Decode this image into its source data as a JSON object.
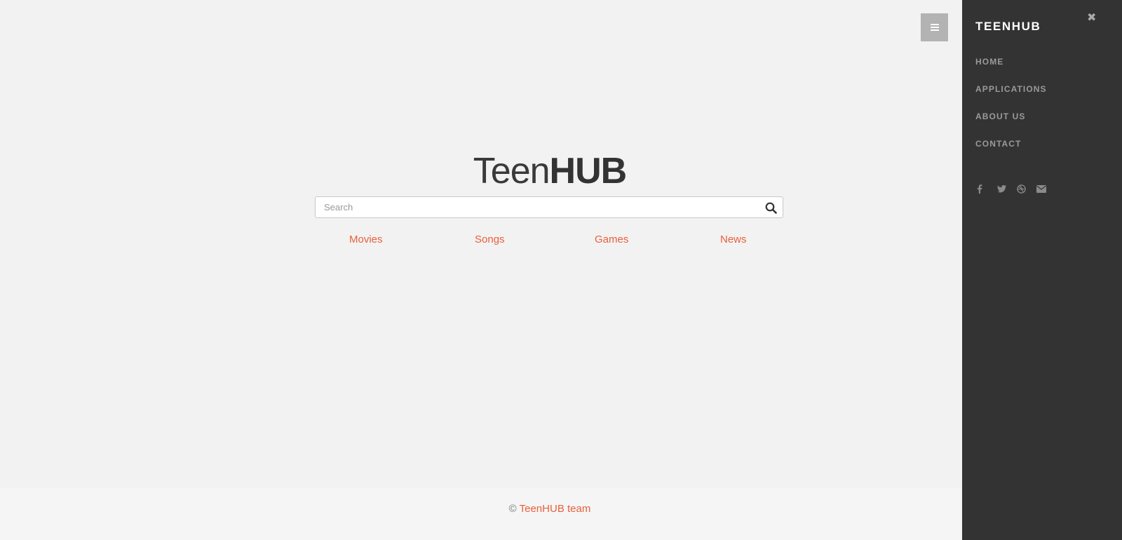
{
  "logo": {
    "part1": "Teen",
    "part2": "HUB"
  },
  "search": {
    "placeholder": "Search",
    "value": ""
  },
  "categories": [
    {
      "label": "Movies"
    },
    {
      "label": "Songs"
    },
    {
      "label": "Games"
    },
    {
      "label": "News"
    }
  ],
  "footer": {
    "copyright_symbol": "©",
    "team_link": "TeenHUB team"
  },
  "sidebar": {
    "brand": "TEENHUB",
    "close_glyph": "✖",
    "nav": [
      {
        "label": "HOME"
      },
      {
        "label": "APPLICATIONS"
      },
      {
        "label": "ABOUT US"
      },
      {
        "label": "CONTACT"
      }
    ],
    "social_icons": [
      "facebook-icon",
      "twitter-icon",
      "dribbble-icon",
      "envelope-icon"
    ]
  },
  "colors": {
    "accent": "#e8603c",
    "sidebar_bg": "#333333",
    "page_bg": "#f2f2f2",
    "toggle_bg": "#b3b3b3"
  }
}
